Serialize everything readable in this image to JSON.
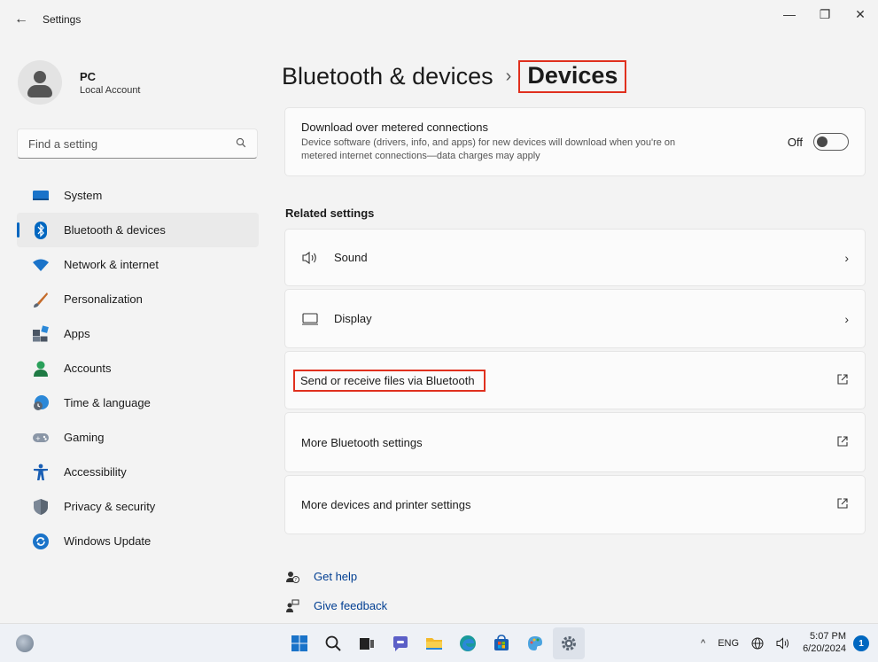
{
  "window": {
    "title": "Settings",
    "back_glyph": "←",
    "minimize_glyph": "—",
    "maximize_glyph": "❐",
    "close_glyph": "✕"
  },
  "profile": {
    "name": "PC",
    "account_type": "Local Account"
  },
  "search": {
    "placeholder": "Find a setting"
  },
  "sidebar": {
    "items": [
      {
        "label": "System",
        "icon": "system-icon"
      },
      {
        "label": "Bluetooth & devices",
        "icon": "bluetooth-icon",
        "active": true
      },
      {
        "label": "Network & internet",
        "icon": "wifi-icon"
      },
      {
        "label": "Personalization",
        "icon": "brush-icon"
      },
      {
        "label": "Apps",
        "icon": "apps-icon"
      },
      {
        "label": "Accounts",
        "icon": "accounts-icon"
      },
      {
        "label": "Time & language",
        "icon": "clock-globe-icon"
      },
      {
        "label": "Gaming",
        "icon": "gamepad-icon"
      },
      {
        "label": "Accessibility",
        "icon": "accessibility-icon"
      },
      {
        "label": "Privacy & security",
        "icon": "shield-icon"
      },
      {
        "label": "Windows Update",
        "icon": "update-icon"
      }
    ]
  },
  "breadcrumb": {
    "parent": "Bluetooth & devices",
    "separator": "›",
    "current": "Devices"
  },
  "metered": {
    "title": "Download over metered connections",
    "description": "Device software (drivers, info, and apps) for new devices will download when you're on metered internet connections—data charges may apply",
    "toggle_label": "Off",
    "toggle_state": false
  },
  "related": {
    "heading": "Related settings",
    "items": [
      {
        "label": "Sound",
        "icon": "speaker-icon",
        "action": "chevron"
      },
      {
        "label": "Display",
        "icon": "monitor-icon",
        "action": "chevron"
      },
      {
        "label": "Send or receive files via Bluetooth",
        "action": "external"
      },
      {
        "label": "More Bluetooth settings",
        "action": "external"
      },
      {
        "label": "More devices and printer settings",
        "action": "external"
      }
    ],
    "chevron_glyph": "›"
  },
  "help": {
    "get_help": "Get help",
    "give_feedback": "Give feedback"
  },
  "taskbar": {
    "language": "ENG",
    "time": "5:07 PM",
    "date": "6/20/2024",
    "notification_count": "1",
    "tray_up_glyph": "^"
  },
  "colors": {
    "accent": "#0067c0",
    "highlight_box": "#e0301e",
    "window_bg": "#f3f3f3",
    "card_bg": "#fbfbfb"
  }
}
